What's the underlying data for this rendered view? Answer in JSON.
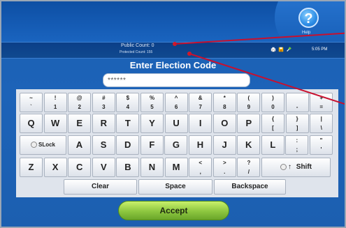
{
  "status": {
    "public_count": "Public Count: 0",
    "protected_count": "Protected Count: 155",
    "time": "5:05 PM",
    "icons": [
      "printer-icon",
      "disk-icon",
      "power-plug-icon"
    ]
  },
  "help": {
    "glyph": "?",
    "label": "Help"
  },
  "screen_title": "Enter Election Code",
  "code_field": {
    "value": "******"
  },
  "keyboard": {
    "row1": [
      {
        "top": "~",
        "bot": "`"
      },
      {
        "top": "!",
        "bot": "1"
      },
      {
        "top": "@",
        "bot": "2"
      },
      {
        "top": "#",
        "bot": "3"
      },
      {
        "top": "$",
        "bot": "4"
      },
      {
        "top": "%",
        "bot": "5"
      },
      {
        "top": "^",
        "bot": "6"
      },
      {
        "top": "&",
        "bot": "7"
      },
      {
        "top": "*",
        "bot": "8"
      },
      {
        "top": "(",
        "bot": "9"
      },
      {
        "top": ")",
        "bot": "0"
      },
      {
        "top": "",
        "bot": "-"
      },
      {
        "top": "+",
        "bot": "="
      }
    ],
    "row2": [
      "Q",
      "W",
      "E",
      "R",
      "T",
      "Y",
      "U",
      "I",
      "O",
      "P",
      {
        "top": "{",
        "bot": "["
      },
      {
        "top": "}",
        "bot": "]"
      },
      {
        "top": "|",
        "bot": "\\"
      }
    ],
    "row3": {
      "slock": "SLock",
      "letters": [
        "A",
        "S",
        "D",
        "F",
        "G",
        "H",
        "J",
        "K",
        "L"
      ],
      "punct": [
        {
          "top": ":",
          "bot": ";"
        },
        {
          "top": "\"",
          "bot": "'"
        }
      ]
    },
    "row4": {
      "letters": [
        "Z",
        "X",
        "C",
        "V",
        "B",
        "N",
        "M"
      ],
      "punct": [
        {
          "top": "<",
          "bot": ","
        },
        {
          "top": ">",
          "bot": "."
        },
        {
          "top": "?",
          "bot": "/"
        }
      ],
      "shift": "Shift"
    },
    "row5": {
      "clear": "Clear",
      "space": "Space",
      "backspace": "Backspace"
    }
  },
  "accept_label": "Accept",
  "colors": {
    "screen_blue": "#1c5fb0",
    "accept_green": "#8cc63f",
    "annotation_red": "#c8102e"
  }
}
